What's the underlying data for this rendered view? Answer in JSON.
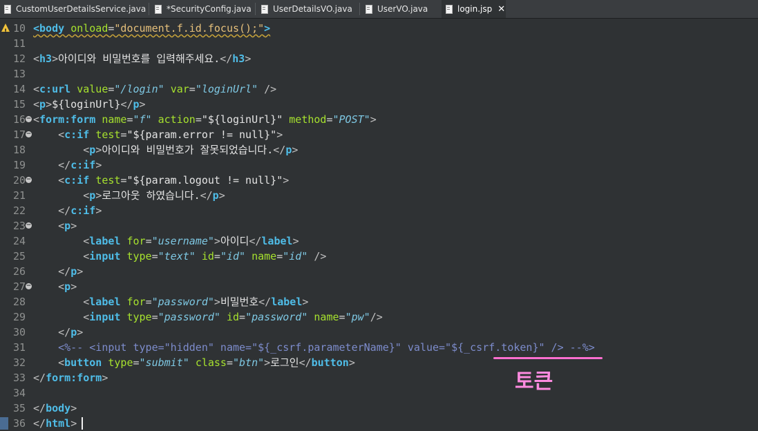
{
  "tabs": [
    {
      "label": "CustomUserDetailsService.java",
      "active": false
    },
    {
      "label": "*SecurityConfig.java",
      "active": false
    },
    {
      "label": "UserDetailsVO.java",
      "active": false
    },
    {
      "label": "UserVO.java",
      "active": false
    },
    {
      "label": "login.jsp",
      "active": true
    }
  ],
  "tab_close_symbol": "✕",
  "lines": [
    {
      "n": "10",
      "tokens": [
        [
          "t-tag",
          "<"
        ],
        [
          "t-tag",
          "body"
        ],
        [
          "t-el",
          " "
        ],
        [
          "t-attr",
          "onload"
        ],
        [
          "t-el",
          "="
        ],
        [
          "t-valx",
          "\"document.f.id.focus();\""
        ],
        [
          "t-tag",
          ">"
        ]
      ]
    },
    {
      "n": "11",
      "tokens": []
    },
    {
      "n": "12",
      "tokens": [
        [
          "t-br",
          "<"
        ],
        [
          "t-tag",
          "h3"
        ],
        [
          "t-br",
          ">"
        ],
        [
          "t-txt",
          "아이디와 비밀번호를 입력해주세요."
        ],
        [
          "t-br",
          "</"
        ],
        [
          "t-tag",
          "h3"
        ],
        [
          "t-br",
          ">"
        ]
      ]
    },
    {
      "n": "13",
      "tokens": []
    },
    {
      "n": "14",
      "tokens": [
        [
          "t-br",
          "<"
        ],
        [
          "t-tag",
          "c:url"
        ],
        [
          "t-el",
          " "
        ],
        [
          "t-attr",
          "value"
        ],
        [
          "t-el",
          "="
        ],
        [
          "t-val",
          "\"/login\""
        ],
        [
          "t-el",
          " "
        ],
        [
          "t-attr",
          "var"
        ],
        [
          "t-el",
          "="
        ],
        [
          "t-val",
          "\"loginUrl\""
        ],
        [
          "t-el",
          " "
        ],
        [
          "t-br",
          "/>"
        ]
      ]
    },
    {
      "n": "15",
      "tokens": [
        [
          "t-br",
          "<"
        ],
        [
          "t-tag",
          "p"
        ],
        [
          "t-br",
          ">"
        ],
        [
          "t-txt",
          "${loginUrl}"
        ],
        [
          "t-br",
          "</"
        ],
        [
          "t-tag",
          "p"
        ],
        [
          "t-br",
          ">"
        ]
      ]
    },
    {
      "n": "16",
      "tokens": [
        [
          "t-br",
          "<"
        ],
        [
          "t-tag",
          "form:form"
        ],
        [
          "t-el",
          " "
        ],
        [
          "t-attr",
          "name"
        ],
        [
          "t-el",
          "="
        ],
        [
          "t-val",
          "\"f\""
        ],
        [
          "t-el",
          " "
        ],
        [
          "t-attr",
          "action"
        ],
        [
          "t-el",
          "="
        ],
        [
          "t-txt",
          "\"${loginUrl}\""
        ],
        [
          "t-el",
          " "
        ],
        [
          "t-attr",
          "method"
        ],
        [
          "t-el",
          "="
        ],
        [
          "t-val",
          "\"POST\""
        ],
        [
          "t-br",
          ">"
        ]
      ]
    },
    {
      "n": "17",
      "tokens": [
        [
          "t-el",
          "    "
        ],
        [
          "t-br",
          "<"
        ],
        [
          "t-tag",
          "c:if"
        ],
        [
          "t-el",
          " "
        ],
        [
          "t-attr",
          "test"
        ],
        [
          "t-el",
          "="
        ],
        [
          "t-txt",
          "\"${param.error != null}\""
        ],
        [
          "t-br",
          ">"
        ]
      ]
    },
    {
      "n": "18",
      "tokens": [
        [
          "t-el",
          "        "
        ],
        [
          "t-br",
          "<"
        ],
        [
          "t-tag",
          "p"
        ],
        [
          "t-br",
          ">"
        ],
        [
          "t-txt",
          "아이디와 비밀번호가 잘못되었습니다."
        ],
        [
          "t-br",
          "</"
        ],
        [
          "t-tag",
          "p"
        ],
        [
          "t-br",
          ">"
        ]
      ]
    },
    {
      "n": "19",
      "tokens": [
        [
          "t-el",
          "    "
        ],
        [
          "t-br",
          "</"
        ],
        [
          "t-tag",
          "c:if"
        ],
        [
          "t-br",
          ">"
        ]
      ]
    },
    {
      "n": "20",
      "tokens": [
        [
          "t-el",
          "    "
        ],
        [
          "t-br",
          "<"
        ],
        [
          "t-tag",
          "c:if"
        ],
        [
          "t-el",
          " "
        ],
        [
          "t-attr",
          "test"
        ],
        [
          "t-el",
          "="
        ],
        [
          "t-txt",
          "\"${param.logout != null}\""
        ],
        [
          "t-br",
          ">"
        ]
      ]
    },
    {
      "n": "21",
      "tokens": [
        [
          "t-el",
          "        "
        ],
        [
          "t-br",
          "<"
        ],
        [
          "t-tag",
          "p"
        ],
        [
          "t-br",
          ">"
        ],
        [
          "t-txt",
          "로그아웃 하였습니다."
        ],
        [
          "t-br",
          "</"
        ],
        [
          "t-tag",
          "p"
        ],
        [
          "t-br",
          ">"
        ]
      ]
    },
    {
      "n": "22",
      "tokens": [
        [
          "t-el",
          "    "
        ],
        [
          "t-br",
          "</"
        ],
        [
          "t-tag",
          "c:if"
        ],
        [
          "t-br",
          ">"
        ]
      ]
    },
    {
      "n": "23",
      "tokens": [
        [
          "t-el",
          "    "
        ],
        [
          "t-br",
          "<"
        ],
        [
          "t-tag",
          "p"
        ],
        [
          "t-br",
          ">"
        ]
      ]
    },
    {
      "n": "24",
      "tokens": [
        [
          "t-el",
          "        "
        ],
        [
          "t-br",
          "<"
        ],
        [
          "t-tag",
          "label"
        ],
        [
          "t-el",
          " "
        ],
        [
          "t-attr",
          "for"
        ],
        [
          "t-el",
          "="
        ],
        [
          "t-val",
          "\"username\""
        ],
        [
          "t-br",
          ">"
        ],
        [
          "t-txt",
          "아이디"
        ],
        [
          "t-br",
          "</"
        ],
        [
          "t-tag",
          "label"
        ],
        [
          "t-br",
          ">"
        ]
      ]
    },
    {
      "n": "25",
      "tokens": [
        [
          "t-el",
          "        "
        ],
        [
          "t-br",
          "<"
        ],
        [
          "t-tag",
          "input"
        ],
        [
          "t-el",
          " "
        ],
        [
          "t-attr",
          "type"
        ],
        [
          "t-el",
          "="
        ],
        [
          "t-val",
          "\"text\""
        ],
        [
          "t-el",
          " "
        ],
        [
          "t-attr",
          "id"
        ],
        [
          "t-el",
          "="
        ],
        [
          "t-val",
          "\"id\""
        ],
        [
          "t-el",
          " "
        ],
        [
          "t-attr",
          "name"
        ],
        [
          "t-el",
          "="
        ],
        [
          "t-val",
          "\"id\""
        ],
        [
          "t-el",
          " "
        ],
        [
          "t-br",
          "/>"
        ]
      ]
    },
    {
      "n": "26",
      "tokens": [
        [
          "t-el",
          "    "
        ],
        [
          "t-br",
          "</"
        ],
        [
          "t-tag",
          "p"
        ],
        [
          "t-br",
          ">"
        ]
      ]
    },
    {
      "n": "27",
      "tokens": [
        [
          "t-el",
          "    "
        ],
        [
          "t-br",
          "<"
        ],
        [
          "t-tag",
          "p"
        ],
        [
          "t-br",
          ">"
        ]
      ]
    },
    {
      "n": "28",
      "tokens": [
        [
          "t-el",
          "        "
        ],
        [
          "t-br",
          "<"
        ],
        [
          "t-tag",
          "label"
        ],
        [
          "t-el",
          " "
        ],
        [
          "t-attr",
          "for"
        ],
        [
          "t-el",
          "="
        ],
        [
          "t-val",
          "\"password\""
        ],
        [
          "t-br",
          ">"
        ],
        [
          "t-txt",
          "비밀번호"
        ],
        [
          "t-br",
          "</"
        ],
        [
          "t-tag",
          "label"
        ],
        [
          "t-br",
          ">"
        ]
      ]
    },
    {
      "n": "29",
      "tokens": [
        [
          "t-el",
          "        "
        ],
        [
          "t-br",
          "<"
        ],
        [
          "t-tag",
          "input"
        ],
        [
          "t-el",
          " "
        ],
        [
          "t-attr",
          "type"
        ],
        [
          "t-el",
          "="
        ],
        [
          "t-val",
          "\"password\""
        ],
        [
          "t-el",
          " "
        ],
        [
          "t-attr",
          "id"
        ],
        [
          "t-el",
          "="
        ],
        [
          "t-val",
          "\"password\""
        ],
        [
          "t-el",
          " "
        ],
        [
          "t-attr",
          "name"
        ],
        [
          "t-el",
          "="
        ],
        [
          "t-val",
          "\"pw\""
        ],
        [
          "t-br",
          "/>"
        ]
      ]
    },
    {
      "n": "30",
      "tokens": [
        [
          "t-el",
          "    "
        ],
        [
          "t-br",
          "</"
        ],
        [
          "t-tag",
          "p"
        ],
        [
          "t-br",
          ">"
        ]
      ]
    },
    {
      "n": "31",
      "tokens": [
        [
          "t-el",
          "    "
        ],
        [
          "t-cm",
          "<%-- <input type=\"hidden\" name=\"${_csrf.parameterName}\" value=\"${_csrf.token}\" /> --%>"
        ]
      ]
    },
    {
      "n": "32",
      "tokens": [
        [
          "t-el",
          "    "
        ],
        [
          "t-br",
          "<"
        ],
        [
          "t-tag",
          "button"
        ],
        [
          "t-el",
          " "
        ],
        [
          "t-attr",
          "type"
        ],
        [
          "t-el",
          "="
        ],
        [
          "t-val",
          "\"submit\""
        ],
        [
          "t-el",
          " "
        ],
        [
          "t-attr",
          "class"
        ],
        [
          "t-el",
          "="
        ],
        [
          "t-val",
          "\"btn\""
        ],
        [
          "t-br",
          ">"
        ],
        [
          "t-txt",
          "로그인"
        ],
        [
          "t-br",
          "</"
        ],
        [
          "t-tag",
          "button"
        ],
        [
          "t-br",
          ">"
        ]
      ]
    },
    {
      "n": "33",
      "tokens": [
        [
          "t-br",
          "</"
        ],
        [
          "t-tag",
          "form:form"
        ],
        [
          "t-br",
          ">"
        ]
      ]
    },
    {
      "n": "34",
      "tokens": []
    },
    {
      "n": "35",
      "tokens": [
        [
          "t-br",
          "</"
        ],
        [
          "t-tag",
          "body"
        ],
        [
          "t-br",
          ">"
        ]
      ]
    },
    {
      "n": "36",
      "tokens": [
        [
          "t-br",
          "</"
        ],
        [
          "t-tag",
          "html"
        ],
        [
          "t-br",
          ">"
        ]
      ]
    }
  ],
  "fold_markers": [
    "16",
    "17",
    "20",
    "23",
    "27"
  ],
  "fold_symbol": "−",
  "warning_line": "10",
  "bookmark_line": "36",
  "annotation": {
    "label": "토큰",
    "color": "#ff8be0"
  }
}
